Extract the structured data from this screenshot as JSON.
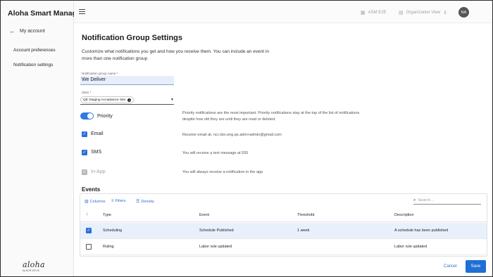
{
  "app": {
    "title": "Aloha Smart Manager"
  },
  "sidebar": {
    "back_label": "My account",
    "items": [
      {
        "label": "Account preferences"
      },
      {
        "label": "Notification settings"
      }
    ],
    "logo": {
      "word": "aloha",
      "by": "by NCR VOYIX"
    }
  },
  "topbar": {
    "asm_label": "ASM E2E",
    "org_label": "Organization View",
    "avatar_initials": "NA"
  },
  "page": {
    "title": "Notification Group Settings",
    "description": "Customize what notifications you get and how you receive them. You can include an event in more than one notification group"
  },
  "form": {
    "name_label": "Notification group name *",
    "name_value": "We Deliver",
    "sites_label": "Sites *",
    "site_chip": "QE Staging Acceptance Site",
    "priority": {
      "label": "Priority",
      "enabled": true,
      "description": "Priority notifications are the most important. Priority notifications stay at the top of the list of notifications despite how old they are until they are read or deleted."
    },
    "email": {
      "label": "Email",
      "checked": true,
      "description": "Receive email at: ncr.cbo.eng.qe.adm+admin@gmail.com"
    },
    "sms": {
      "label": "SMS",
      "checked": true,
      "description": "You will receive a text message at 555"
    },
    "inapp": {
      "label": "In-App",
      "checked": true,
      "disabled": true,
      "description": "You will always receive a notification in the app"
    }
  },
  "events": {
    "title": "Events",
    "toolbar": {
      "columns": "Columns",
      "filters": "Filters",
      "density": "Density",
      "search_placeholder": "Search…"
    },
    "columns": [
      "Type",
      "Event",
      "Threshold",
      "Description"
    ],
    "rows": [
      {
        "type": "Scheduling",
        "event": "Schedule Published",
        "threshold": "1 week",
        "description": "A schedule has been published",
        "checked": true
      },
      {
        "type": "Ruling",
        "event": "Labor rule updated",
        "threshold": "",
        "description": "Labor rule updated",
        "checked": false
      }
    ]
  },
  "footer": {
    "cancel": "Cancel",
    "save": "Save"
  },
  "colors": {
    "accent": "#1f6fd6",
    "selected_row": "#e8f0fc"
  }
}
